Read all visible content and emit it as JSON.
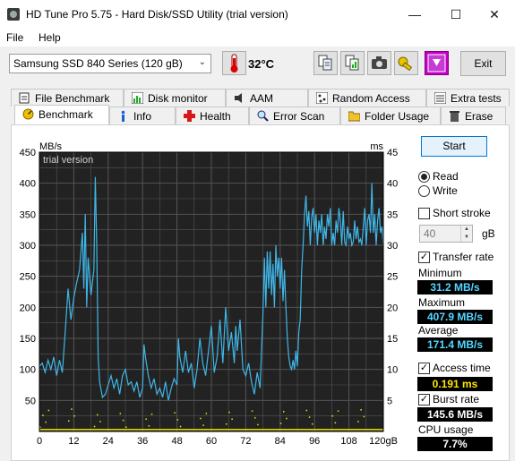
{
  "window": {
    "title": "HD Tune Pro 5.75 - Hard Disk/SSD Utility (trial version)",
    "minimize": "—",
    "maximize": "☐",
    "close": "✕"
  },
  "menu": {
    "file": "File",
    "help": "Help"
  },
  "toolbar": {
    "drive": "Samsung SSD 840 Series (120 gB)",
    "temperature": "32°C",
    "exit_label": "Exit"
  },
  "tabs_row1": [
    {
      "label": "File Benchmark",
      "icon": "file-benchmark-icon"
    },
    {
      "label": "Disk monitor",
      "icon": "disk-monitor-icon"
    },
    {
      "label": "AAM",
      "icon": "speaker-icon"
    },
    {
      "label": "Random Access",
      "icon": "random-access-icon"
    },
    {
      "label": "Extra tests",
      "icon": "extra-tests-icon"
    }
  ],
  "tabs_row2": [
    {
      "label": "Benchmark",
      "icon": "benchmark-icon",
      "active": true
    },
    {
      "label": "Info",
      "icon": "info-icon"
    },
    {
      "label": "Health",
      "icon": "health-cross-icon"
    },
    {
      "label": "Error Scan",
      "icon": "magnifier-icon"
    },
    {
      "label": "Folder Usage",
      "icon": "folder-icon"
    },
    {
      "label": "Erase",
      "icon": "trash-icon"
    }
  ],
  "chart_data": {
    "type": "line",
    "watermark": "trial version",
    "ylabel_left": "MB/s",
    "ylabel_right": "ms",
    "yticks_left": [
      50,
      100,
      150,
      200,
      250,
      300,
      350,
      400,
      450
    ],
    "yticks_right": [
      5,
      10,
      15,
      20,
      25,
      30,
      35,
      40,
      45
    ],
    "ylim_left": [
      0,
      450
    ],
    "ylim_right": [
      0,
      45
    ],
    "xticks": [
      "0",
      "12",
      "24",
      "36",
      "48",
      "60",
      "72",
      "84",
      "96",
      "108",
      "120gB"
    ],
    "xlim": [
      0,
      120
    ],
    "grid": true,
    "colors": {
      "background": "#222222",
      "grid": "#555555",
      "transfer": "#3fb6e8",
      "access": "#e8e800"
    },
    "series": [
      {
        "values": [
          [
            0,
            105
          ],
          [
            1,
            110
          ],
          [
            2,
            95
          ],
          [
            3,
            115
          ],
          [
            4,
            100
          ],
          [
            5,
            120
          ],
          [
            6,
            90
          ],
          [
            7,
            115
          ],
          [
            8,
            95
          ],
          [
            9,
            160
          ],
          [
            10,
            230
          ],
          [
            11,
            180
          ],
          [
            12,
            215
          ],
          [
            13,
            240
          ],
          [
            14,
            260
          ],
          [
            15,
            320
          ],
          [
            15.5,
            230
          ],
          [
            16,
            350
          ],
          [
            16.5,
            200
          ],
          [
            17,
            280
          ],
          [
            18,
            220
          ],
          [
            19,
            260
          ],
          [
            19.5,
            410
          ],
          [
            20,
            300
          ],
          [
            20.5,
            120
          ],
          [
            21,
            80
          ],
          [
            22,
            55
          ],
          [
            23,
            60
          ],
          [
            24,
            75
          ],
          [
            25,
            90
          ],
          [
            26,
            70
          ],
          [
            27,
            85
          ],
          [
            28,
            60
          ],
          [
            29,
            90
          ],
          [
            30,
            100
          ],
          [
            31,
            75
          ],
          [
            32,
            80
          ],
          [
            33,
            65
          ],
          [
            34,
            80
          ],
          [
            35,
            55
          ],
          [
            36,
            70
          ],
          [
            36.5,
            140
          ],
          [
            37,
            120
          ],
          [
            38,
            90
          ],
          [
            39,
            70
          ],
          [
            40,
            85
          ],
          [
            41,
            60
          ],
          [
            42,
            70
          ],
          [
            43,
            55
          ],
          [
            44,
            80
          ],
          [
            45,
            50
          ],
          [
            46,
            70
          ],
          [
            47,
            85
          ],
          [
            48,
            75
          ],
          [
            48.5,
            150
          ],
          [
            49,
            120
          ],
          [
            50,
            95
          ],
          [
            51,
            130
          ],
          [
            52,
            95
          ],
          [
            53,
            110
          ],
          [
            54,
            70
          ],
          [
            55,
            100
          ],
          [
            56,
            150
          ],
          [
            57,
            110
          ],
          [
            58,
            90
          ],
          [
            59,
            130
          ],
          [
            60,
            170
          ],
          [
            61,
            95
          ],
          [
            62,
            120
          ],
          [
            63,
            180
          ],
          [
            64,
            110
          ],
          [
            65,
            200
          ],
          [
            66,
            130
          ],
          [
            67,
            160
          ],
          [
            68,
            110
          ],
          [
            68.5,
            170
          ],
          [
            69,
            130
          ],
          [
            70,
            180
          ],
          [
            71,
            100
          ],
          [
            72,
            90
          ],
          [
            73,
            110
          ],
          [
            74,
            80
          ],
          [
            75,
            60
          ],
          [
            76,
            95
          ],
          [
            77,
            70
          ],
          [
            78,
            190
          ],
          [
            78.5,
            280
          ],
          [
            79,
            200
          ],
          [
            79.5,
            290
          ],
          [
            80,
            230
          ],
          [
            80.5,
            290
          ],
          [
            81,
            220
          ],
          [
            81.5,
            270
          ],
          [
            82,
            200
          ],
          [
            82.5,
            300
          ],
          [
            83,
            250
          ],
          [
            83.5,
            280
          ],
          [
            84,
            230
          ],
          [
            84.5,
            280
          ],
          [
            85,
            210
          ],
          [
            85.5,
            260
          ],
          [
            86,
            200
          ],
          [
            86.5,
            150
          ],
          [
            87,
            120
          ],
          [
            87.5,
            105
          ],
          [
            88,
            100
          ],
          [
            88.5,
            115
          ],
          [
            89,
            100
          ],
          [
            89.5,
            130
          ],
          [
            90,
            105
          ],
          [
            90.5,
            160
          ],
          [
            91,
            180
          ],
          [
            91.5,
            260
          ],
          [
            92,
            300
          ],
          [
            92.5,
            350
          ],
          [
            93,
            380
          ],
          [
            93.5,
            330
          ],
          [
            94,
            355
          ],
          [
            94.5,
            300
          ],
          [
            95,
            345
          ],
          [
            95.5,
            360
          ],
          [
            96,
            320
          ],
          [
            96.5,
            350
          ],
          [
            97,
            300
          ],
          [
            97.5,
            340
          ],
          [
            98,
            320
          ],
          [
            98.5,
            350
          ],
          [
            99,
            300
          ],
          [
            99.5,
            330
          ],
          [
            100,
            310
          ],
          [
            100.5,
            350
          ],
          [
            101,
            330
          ],
          [
            101.5,
            360
          ],
          [
            102,
            300
          ],
          [
            102.5,
            320
          ],
          [
            103,
            300
          ],
          [
            103.5,
            340
          ],
          [
            104,
            320
          ],
          [
            104.5,
            360
          ],
          [
            105,
            340
          ],
          [
            105.5,
            300
          ],
          [
            106,
            355
          ],
          [
            106.5,
            305
          ],
          [
            107,
            300
          ],
          [
            107.5,
            330
          ],
          [
            108,
            310
          ],
          [
            108.5,
            320
          ],
          [
            109,
            300
          ],
          [
            109.5,
            305
          ],
          [
            110,
            340
          ],
          [
            110.5,
            310
          ],
          [
            111,
            330
          ],
          [
            111.5,
            305
          ],
          [
            112,
            310
          ],
          [
            112.5,
            300
          ],
          [
            113,
            330
          ],
          [
            113.5,
            360
          ],
          [
            114,
            300
          ],
          [
            114.5,
            340
          ],
          [
            115,
            350
          ],
          [
            115.5,
            320
          ],
          [
            116,
            400
          ],
          [
            116.5,
            320
          ],
          [
            117,
            350
          ],
          [
            117.5,
            300
          ],
          [
            118,
            340
          ],
          [
            118.5,
            360
          ],
          [
            119,
            320
          ],
          [
            119.5,
            330
          ],
          [
            120,
            300
          ]
        ]
      }
    ]
  },
  "panel": {
    "start_label": "Start",
    "read_label": "Read",
    "write_label": "Write",
    "short_stroke_label": "Short stroke",
    "stroke_value": "40",
    "stroke_unit": "gB",
    "transfer_rate_label": "Transfer rate",
    "minimum_label": "Minimum",
    "minimum_value": "31.2 MB/s",
    "maximum_label": "Maximum",
    "maximum_value": "407.9 MB/s",
    "average_label": "Average",
    "average_value": "171.4 MB/s",
    "access_time_label": "Access time",
    "access_time_value": "0.191 ms",
    "burst_rate_label": "Burst rate",
    "burst_rate_value": "145.6 MB/s",
    "cpu_usage_label": "CPU usage",
    "cpu_usage_value": "7.7%"
  }
}
